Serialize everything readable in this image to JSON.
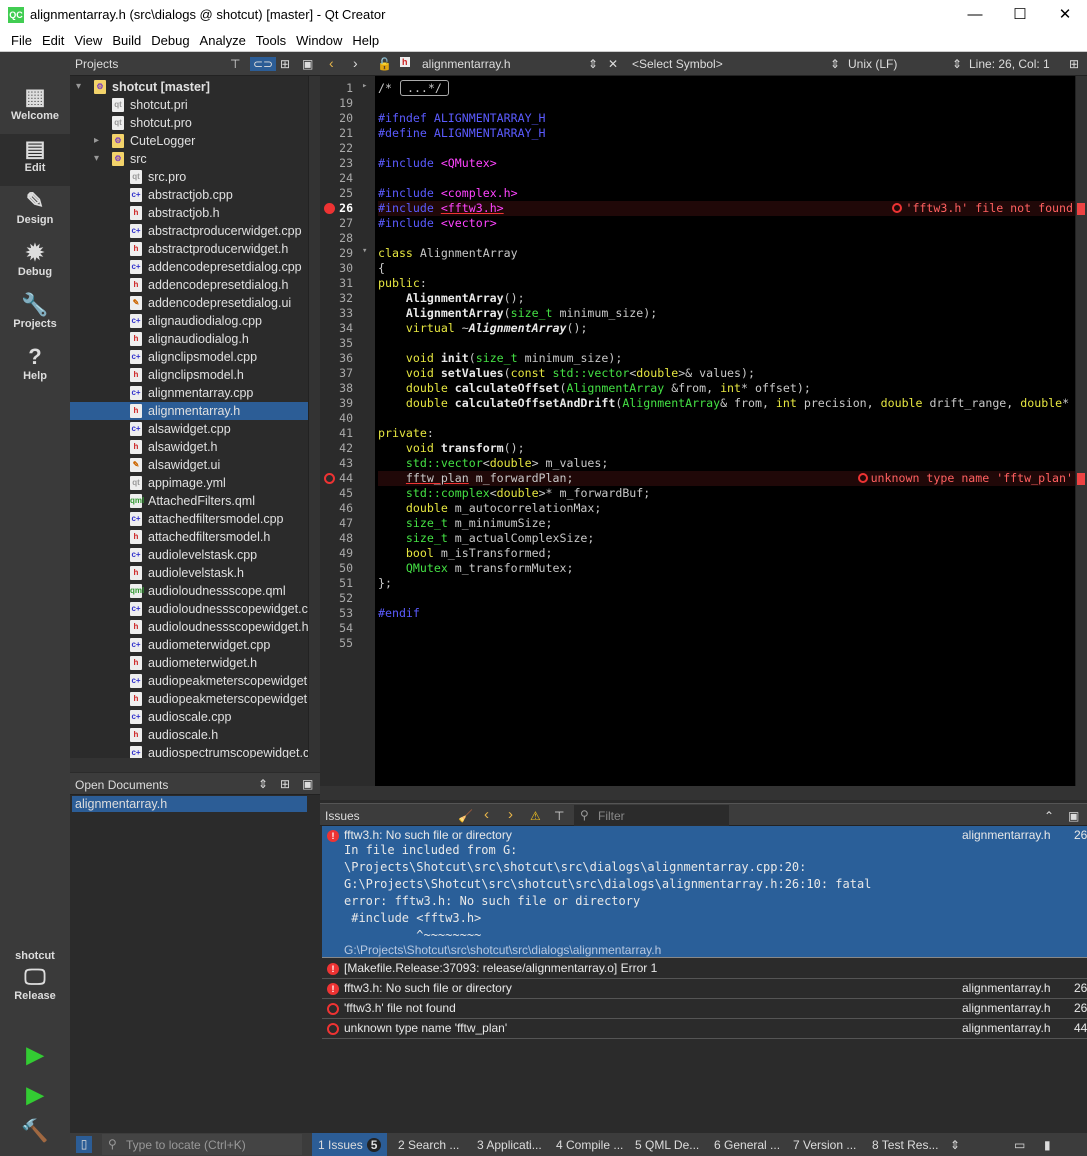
{
  "window": {
    "title": "alignmentarray.h (src\\dialogs @ shotcut) [master] - Qt Creator",
    "logo": "QC",
    "min": "—",
    "max": "☐",
    "close": "✕"
  },
  "menu": [
    "File",
    "Edit",
    "View",
    "Build",
    "Debug",
    "Analyze",
    "Tools",
    "Window",
    "Help"
  ],
  "modes": [
    {
      "label": "Welcome",
      "icon": "▦"
    },
    {
      "label": "Edit",
      "icon": "▤"
    },
    {
      "label": "Design",
      "icon": "✎"
    },
    {
      "label": "Debug",
      "icon": "✹"
    },
    {
      "label": "Projects",
      "icon": "🔧"
    },
    {
      "label": "Help",
      "icon": "?"
    }
  ],
  "kit": {
    "project": "shotcut",
    "config": "Release"
  },
  "projects_pane": {
    "title": "Projects"
  },
  "tree": [
    {
      "label": "shotcut [master]",
      "icon": "fold",
      "indent": 0,
      "arrow": "▾",
      "bold": true
    },
    {
      "label": "shotcut.pri",
      "icon": "pro",
      "indent": 1
    },
    {
      "label": "shotcut.pro",
      "icon": "pro",
      "indent": 1
    },
    {
      "label": "CuteLogger",
      "icon": "fold",
      "indent": 1,
      "arrow": "▸"
    },
    {
      "label": "src",
      "icon": "fold",
      "indent": 1,
      "arrow": "▾"
    },
    {
      "label": "src.pro",
      "icon": "pro",
      "indent": 2
    },
    {
      "label": "abstractjob.cpp",
      "icon": "cpp",
      "indent": 2
    },
    {
      "label": "abstractjob.h",
      "icon": "h",
      "indent": 2
    },
    {
      "label": "abstractproducerwidget.cpp",
      "icon": "cpp",
      "indent": 2
    },
    {
      "label": "abstractproducerwidget.h",
      "icon": "h",
      "indent": 2
    },
    {
      "label": "addencodepresetdialog.cpp",
      "icon": "cpp",
      "indent": 2
    },
    {
      "label": "addencodepresetdialog.h",
      "icon": "h",
      "indent": 2
    },
    {
      "label": "addencodepresetdialog.ui",
      "icon": "ui",
      "indent": 2
    },
    {
      "label": "alignaudiodialog.cpp",
      "icon": "cpp",
      "indent": 2
    },
    {
      "label": "alignaudiodialog.h",
      "icon": "h",
      "indent": 2
    },
    {
      "label": "alignclipsmodel.cpp",
      "icon": "cpp",
      "indent": 2
    },
    {
      "label": "alignclipsmodel.h",
      "icon": "h",
      "indent": 2
    },
    {
      "label": "alignmentarray.cpp",
      "icon": "cpp",
      "indent": 2
    },
    {
      "label": "alignmentarray.h",
      "icon": "h",
      "indent": 2,
      "selected": true
    },
    {
      "label": "alsawidget.cpp",
      "icon": "cpp",
      "indent": 2
    },
    {
      "label": "alsawidget.h",
      "icon": "h",
      "indent": 2
    },
    {
      "label": "alsawidget.ui",
      "icon": "ui",
      "indent": 2
    },
    {
      "label": "appimage.yml",
      "icon": "pro",
      "indent": 2
    },
    {
      "label": "AttachedFilters.qml",
      "icon": "qml",
      "indent": 2
    },
    {
      "label": "attachedfiltersmodel.cpp",
      "icon": "cpp",
      "indent": 2
    },
    {
      "label": "attachedfiltersmodel.h",
      "icon": "h",
      "indent": 2
    },
    {
      "label": "audiolevelstask.cpp",
      "icon": "cpp",
      "indent": 2
    },
    {
      "label": "audiolevelstask.h",
      "icon": "h",
      "indent": 2
    },
    {
      "label": "audioloudnessscope.qml",
      "icon": "qml",
      "indent": 2
    },
    {
      "label": "audioloudnessscopewidget.cpp",
      "icon": "cpp",
      "indent": 2
    },
    {
      "label": "audioloudnessscopewidget.h",
      "icon": "h",
      "indent": 2
    },
    {
      "label": "audiometerwidget.cpp",
      "icon": "cpp",
      "indent": 2
    },
    {
      "label": "audiometerwidget.h",
      "icon": "h",
      "indent": 2
    },
    {
      "label": "audiopeakmeterscopewidget.cpp",
      "icon": "cpp",
      "indent": 2
    },
    {
      "label": "audiopeakmeterscopewidget.h",
      "icon": "h",
      "indent": 2
    },
    {
      "label": "audioscale.cpp",
      "icon": "cpp",
      "indent": 2
    },
    {
      "label": "audioscale.h",
      "icon": "h",
      "indent": 2
    },
    {
      "label": "audiospectrumscopewidget.cpp",
      "icon": "cpp",
      "indent": 2
    }
  ],
  "open_docs": {
    "title": "Open Documents",
    "items": [
      "alignmentarray.h"
    ]
  },
  "editor_toolbar": {
    "file": "alignmentarray.h",
    "symbol": "<Select Symbol>",
    "line_ending": "Unix (LF)",
    "position": "Line: 26, Col: 1"
  },
  "code": [
    {
      "n": "1",
      "t": [
        [
          "tx",
          "/*"
        ],
        [
          "box",
          "...*/"
        ]
      ]
    },
    {
      "n": "19",
      "t": []
    },
    {
      "n": "20",
      "t": [
        [
          "pp",
          "#ifndef ALIGNMENTARRAY_H"
        ]
      ]
    },
    {
      "n": "21",
      "t": [
        [
          "pp",
          "#define ALIGNMENTARRAY_H"
        ]
      ]
    },
    {
      "n": "22",
      "t": []
    },
    {
      "n": "23",
      "t": [
        [
          "pp",
          "#include "
        ],
        [
          "inc",
          "<QMutex>"
        ]
      ]
    },
    {
      "n": "24",
      "t": []
    },
    {
      "n": "25",
      "t": [
        [
          "pp",
          "#include "
        ],
        [
          "inc",
          "<complex.h>"
        ]
      ]
    },
    {
      "n": "26",
      "t": [
        [
          "pp",
          "#include "
        ],
        [
          "inc ul",
          "<fftw3.h>"
        ]
      ],
      "error": "'fftw3.h' file not found"
    },
    {
      "n": "27",
      "t": [
        [
          "pp",
          "#include "
        ],
        [
          "inc",
          "<vector>"
        ]
      ]
    },
    {
      "n": "28",
      "t": []
    },
    {
      "n": "29",
      "t": [
        [
          "kw",
          "class "
        ],
        [
          "tx",
          "AlignmentArray"
        ]
      ]
    },
    {
      "n": "30",
      "t": [
        [
          "tx",
          "{"
        ]
      ]
    },
    {
      "n": "31",
      "t": [
        [
          "kw",
          "public"
        ],
        [
          "tx",
          ":"
        ]
      ]
    },
    {
      "n": "32",
      "t": [
        [
          "tx",
          "    "
        ],
        [
          "fn",
          "AlignmentArray"
        ],
        [
          "tx",
          "();"
        ]
      ]
    },
    {
      "n": "33",
      "t": [
        [
          "tx",
          "    "
        ],
        [
          "fn",
          "AlignmentArray"
        ],
        [
          "tx",
          "("
        ],
        [
          "ty",
          "size_t"
        ],
        [
          "tx",
          " minimum_size);"
        ]
      ]
    },
    {
      "n": "34",
      "t": [
        [
          "tx",
          "    "
        ],
        [
          "kw",
          "virtual "
        ],
        [
          "tx",
          "~"
        ],
        [
          "it",
          "AlignmentArray"
        ],
        [
          "tx",
          "();"
        ]
      ]
    },
    {
      "n": "35",
      "t": []
    },
    {
      "n": "36",
      "t": [
        [
          "tx",
          "    "
        ],
        [
          "kw",
          "void "
        ],
        [
          "fn",
          "init"
        ],
        [
          "tx",
          "("
        ],
        [
          "ty",
          "size_t"
        ],
        [
          "tx",
          " minimum_size);"
        ]
      ]
    },
    {
      "n": "37",
      "t": [
        [
          "tx",
          "    "
        ],
        [
          "kw",
          "void "
        ],
        [
          "fn",
          "setValues"
        ],
        [
          "tx",
          "("
        ],
        [
          "kw",
          "const "
        ],
        [
          "ty",
          "std::vector"
        ],
        [
          "tx",
          "<"
        ],
        [
          "kw",
          "double"
        ],
        [
          "tx",
          ">& values);"
        ]
      ]
    },
    {
      "n": "38",
      "t": [
        [
          "tx",
          "    "
        ],
        [
          "kw",
          "double "
        ],
        [
          "fn",
          "calculateOffset"
        ],
        [
          "tx",
          "("
        ],
        [
          "ty",
          "AlignmentArray"
        ],
        [
          "tx",
          " &from, "
        ],
        [
          "kw",
          "int"
        ],
        [
          "tx",
          "* offset);"
        ]
      ]
    },
    {
      "n": "39",
      "t": [
        [
          "tx",
          "    "
        ],
        [
          "kw",
          "double "
        ],
        [
          "fn",
          "calculateOffsetAndDrift"
        ],
        [
          "tx",
          "("
        ],
        [
          "ty",
          "AlignmentArray"
        ],
        [
          "tx",
          "& from, "
        ],
        [
          "kw",
          "int"
        ],
        [
          "tx",
          " precision, "
        ],
        [
          "kw",
          "double"
        ],
        [
          "tx",
          " drift_range, "
        ],
        [
          "kw",
          "double"
        ],
        [
          "tx",
          "*"
        ]
      ]
    },
    {
      "n": "40",
      "t": []
    },
    {
      "n": "41",
      "t": [
        [
          "kw",
          "private"
        ],
        [
          "tx",
          ":"
        ]
      ]
    },
    {
      "n": "42",
      "t": [
        [
          "tx",
          "    "
        ],
        [
          "kw",
          "void "
        ],
        [
          "fn",
          "transform"
        ],
        [
          "tx",
          "();"
        ]
      ]
    },
    {
      "n": "43",
      "t": [
        [
          "tx",
          "    "
        ],
        [
          "ty",
          "std::vector"
        ],
        [
          "tx",
          "<"
        ],
        [
          "kw",
          "double"
        ],
        [
          "tx",
          "> m_values;"
        ]
      ]
    },
    {
      "n": "44",
      "t": [
        [
          "tx",
          "    "
        ],
        [
          "tx ul",
          "fftw_plan"
        ],
        [
          "tx",
          " m_forwardPlan;"
        ]
      ],
      "error": "unknown type name 'fftw_plan'"
    },
    {
      "n": "45",
      "t": [
        [
          "tx",
          "    "
        ],
        [
          "ty",
          "std::complex"
        ],
        [
          "tx",
          "<"
        ],
        [
          "kw",
          "double"
        ],
        [
          "tx",
          ">* m_forwardBuf;"
        ]
      ]
    },
    {
      "n": "46",
      "t": [
        [
          "tx",
          "    "
        ],
        [
          "kw",
          "double "
        ],
        [
          "tx",
          "m_autocorrelationMax;"
        ]
      ]
    },
    {
      "n": "47",
      "t": [
        [
          "tx",
          "    "
        ],
        [
          "ty",
          "size_t "
        ],
        [
          "tx",
          "m_minimumSize;"
        ]
      ]
    },
    {
      "n": "48",
      "t": [
        [
          "tx",
          "    "
        ],
        [
          "ty",
          "size_t "
        ],
        [
          "tx",
          "m_actualComplexSize;"
        ]
      ]
    },
    {
      "n": "49",
      "t": [
        [
          "tx",
          "    "
        ],
        [
          "kw",
          "bool "
        ],
        [
          "tx",
          "m_isTransformed;"
        ]
      ]
    },
    {
      "n": "50",
      "t": [
        [
          "tx",
          "    "
        ],
        [
          "ty",
          "QMutex "
        ],
        [
          "tx",
          "m_transformMutex;"
        ]
      ]
    },
    {
      "n": "51",
      "t": [
        [
          "tx",
          "};"
        ]
      ]
    },
    {
      "n": "52",
      "t": []
    },
    {
      "n": "53",
      "t": [
        [
          "pp",
          "#endif"
        ]
      ]
    },
    {
      "n": "54",
      "t": []
    },
    {
      "n": "55",
      "t": []
    }
  ],
  "issues": {
    "title": "Issues",
    "filter_placeholder": "Filter",
    "expanded": {
      "msg": "fftw3.h: No such file or directory",
      "file": "alignmentarray.h",
      "line": "26",
      "detail": [
        "In file included from G:",
        "\\Projects\\Shotcut\\src\\shotcut\\src\\dialogs\\alignmentarray.cpp:20:",
        "G:\\Projects\\Shotcut\\src\\shotcut\\src\\dialogs\\alignmentarray.h:26:10: fatal",
        "error: fftw3.h: No such file or directory",
        " #include <fftw3.h>",
        "          ^~~~~~~~~"
      ],
      "path": "G:\\Projects\\Shotcut\\src\\shotcut\\src\\dialogs\\alignmentarray.h"
    },
    "rows": [
      {
        "kind": "error",
        "msg": "[Makefile.Release:37093: release/alignmentarray.o] Error 1",
        "file": "",
        "line": ""
      },
      {
        "kind": "error",
        "msg": "fftw3.h: No such file or directory",
        "file": "alignmentarray.h",
        "line": "26"
      },
      {
        "kind": "warn",
        "msg": "'fftw3.h' file not found",
        "file": "alignmentarray.h",
        "line": "26"
      },
      {
        "kind": "warn",
        "msg": "unknown type name 'fftw_plan'",
        "file": "alignmentarray.h",
        "line": "44"
      }
    ]
  },
  "statusbar": {
    "locate_placeholder": "Type to locate (Ctrl+K)",
    "tabs": [
      {
        "label": "1  Issues",
        "badge": "5"
      },
      {
        "label": "2  Search ..."
      },
      {
        "label": "3  Applicati..."
      },
      {
        "label": "4  Compile ..."
      },
      {
        "label": "5  QML De..."
      },
      {
        "label": "6  General ..."
      },
      {
        "label": "7  Version ..."
      },
      {
        "label": "8  Test Res..."
      }
    ]
  }
}
